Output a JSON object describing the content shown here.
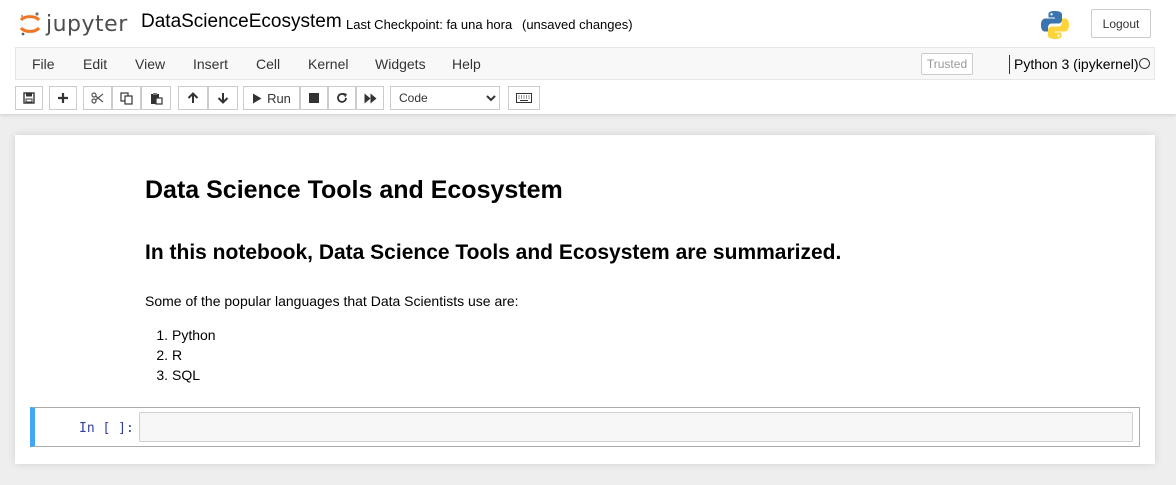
{
  "header": {
    "logo_text": "jupyter",
    "notebook_name": "DataScienceEcosystem",
    "checkpoint": "Last Checkpoint: fa una hora",
    "autosave": "(unsaved changes)",
    "logout_label": "Logout"
  },
  "menubar": {
    "items": [
      "File",
      "Edit",
      "View",
      "Insert",
      "Cell",
      "Kernel",
      "Widgets",
      "Help"
    ],
    "trusted_label": "Trusted",
    "kernel_name": "Python 3 (ipykernel)"
  },
  "toolbar": {
    "run_label": "Run",
    "cell_type": "Code",
    "icons": [
      "save-icon",
      "plus-icon",
      "cut-icon",
      "copy-icon",
      "paste-icon",
      "arrow-up-icon",
      "arrow-down-icon",
      "play-icon",
      "stop-icon",
      "restart-icon",
      "fast-forward-icon",
      "keyboard-icon"
    ]
  },
  "notebook": {
    "h1": "Data Science Tools and Ecosystem",
    "h2": "In this notebook, Data Science Tools and Ecosystem are summarized.",
    "paragraph": "Some of the popular languages that Data Scientists use are:",
    "languages": [
      {
        "num": "1.",
        "name": "Python"
      },
      {
        "num": "2.",
        "name": "R"
      },
      {
        "num": "3.",
        "name": "SQL"
      }
    ],
    "code_prompt": "In [ ]:"
  },
  "colors": {
    "accent_cell": "#42a5f5",
    "logo_orange": "#f37626",
    "prompt_blue": "#303f9f"
  }
}
